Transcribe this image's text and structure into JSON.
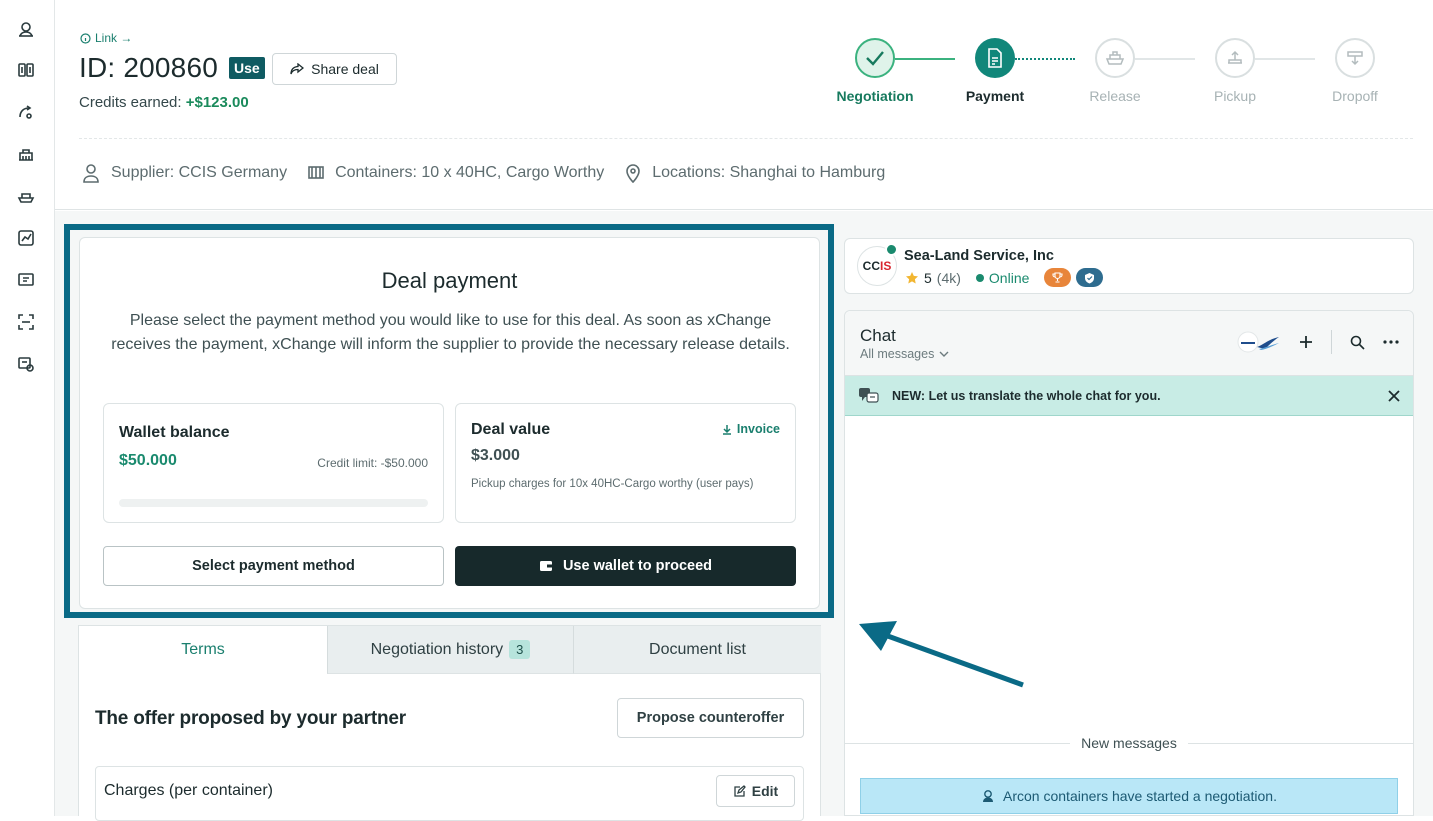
{
  "sidebar": {
    "icons": [
      "user-circle-icon",
      "container-stack-icon",
      "route-icon",
      "depot-icon",
      "ship-icon",
      "chart-icon",
      "dashboard-icon",
      "scan-icon",
      "settings-icon"
    ]
  },
  "header": {
    "link_label": "Link →",
    "deal_id": "ID: 200860",
    "use_badge": "Use",
    "share_label": "Share deal",
    "credits_label": "Credits earned:",
    "credits_value": "+$123.00"
  },
  "stepper": {
    "steps": [
      {
        "label": "Negotiation",
        "state": "done",
        "icon": "check-icon"
      },
      {
        "label": "Payment",
        "state": "active",
        "icon": "payment-doc-icon"
      },
      {
        "label": "Release",
        "state": "pending",
        "icon": "ship-icon"
      },
      {
        "label": "Pickup",
        "state": "pending",
        "icon": "pickup-icon"
      },
      {
        "label": "Dropoff",
        "state": "pending",
        "icon": "dropoff-icon"
      }
    ]
  },
  "meta": {
    "supplier": "Supplier: CCIS Germany",
    "containers": "Containers: 10 x 40HC, Cargo Worthy",
    "locations": "Locations: Shanghai to Hamburg"
  },
  "payment": {
    "title": "Deal payment",
    "description": "Please select the payment method you would like to use for this deal. As soon as xChange receives the payment, xChange will inform the supplier to provide the necessary release details.",
    "wallet": {
      "title": "Wallet balance",
      "amount": "$50.000",
      "credit_limit": "Credit limit: -$50.000",
      "progress_fraction": 0
    },
    "deal": {
      "title": "Deal value",
      "invoice_label": "Invoice",
      "amount": "$3.000",
      "note": "Pickup charges for 10x 40HC-Cargo worthy (user pays)"
    },
    "select_method_label": "Select payment method",
    "use_wallet_label": "Use wallet to proceed"
  },
  "tabs": {
    "items": [
      {
        "label": "Terms",
        "active": true
      },
      {
        "label": "Negotiation history",
        "count": "3",
        "active": false
      },
      {
        "label": "Document list",
        "active": false
      }
    ],
    "offer_title": "The offer proposed by your partner",
    "counteroffer_label": "Propose counteroffer",
    "charges_title": "Charges (per container)",
    "edit_label": "Edit"
  },
  "partner": {
    "logo_text_a": "CC",
    "logo_text_b": "IS",
    "name": "Sea-Land Service, Inc",
    "rating": "5",
    "reviews": "(4k)",
    "status": "Online"
  },
  "chat": {
    "title": "Chat",
    "filter": "All messages",
    "banner": "NEW: Let us translate the whole chat for you.",
    "new_messages": "New messages",
    "system_message": "Arcon containers have started a negotiation."
  },
  "colors": {
    "accent": "#1a7f6e",
    "highlight_frame": "#0a6a86",
    "dark_button": "#17292b"
  }
}
